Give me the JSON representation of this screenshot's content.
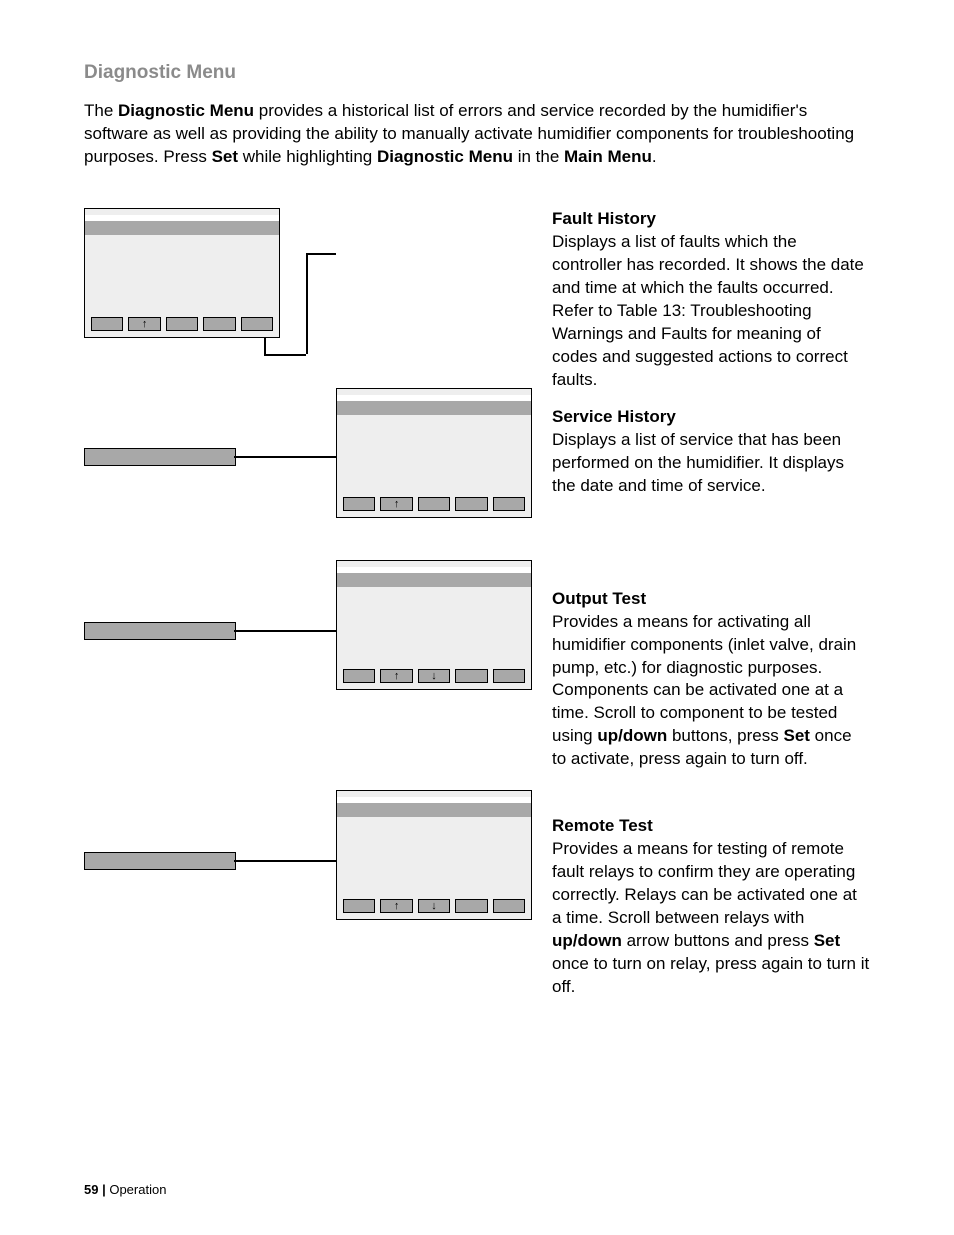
{
  "title": "Diagnostic Menu",
  "intro": {
    "t1": "The ",
    "b1": "Diagnostic Menu",
    "t2": " provides a historical list of errors and service recorded by the humidifier's software as well as providing the ability to manually activate humidifier components for troubleshooting purposes.  Press ",
    "b2": "Set",
    "t3": " while highlighting ",
    "b3": "Diagnostic Menu",
    "t4": " in the ",
    "b4": "Main Menu",
    "t5": "."
  },
  "sections": {
    "fault": {
      "heading": "Fault History",
      "body": "Displays a list of faults which the controller has recorded.  It shows the date and time at which the faults occurred.  Refer to Table 13: Troubleshooting Warnings and Faults for meaning of codes and suggested actions to correct faults."
    },
    "service": {
      "heading": "Service History",
      "body": "Displays a list of service that has been performed on the humidifier.  It displays the date and time of service."
    },
    "output": {
      "heading": "Output Test",
      "b1_pre": "Provides a means for activating all humidifier components (inlet valve, drain pump, etc.) for diagnostic purposes.  Components can be activated one at a time.  Scroll to component to be tested using ",
      "b1_bold1": "up/down",
      "b1_mid": " buttons, press ",
      "b1_bold2": "Set",
      "b1_post": " once to activate, press again to turn off."
    },
    "remote": {
      "heading": "Remote Test",
      "b1_pre": "Provides a means for testing of remote fault relays to confirm they are operating correctly.  Relays can be activated one at a time.  Scroll between relays with ",
      "b1_bold1": "up/down",
      "b1_mid": " arrow buttons and press ",
      "b1_bold2": "Set",
      "b1_post": " once to turn on relay, press again to turn it off."
    }
  },
  "icons": {
    "up": "↑",
    "down": "↓"
  },
  "footer": {
    "page": "59 | ",
    "section": "Operation"
  }
}
